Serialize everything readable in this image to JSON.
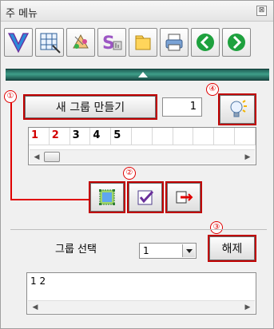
{
  "window": {
    "title": "주 메뉴",
    "close_glyph": "⊠"
  },
  "toolbar": {
    "icons": [
      "v-icon",
      "grid-edit-icon",
      "paint-icon",
      "s-chart-icon",
      "folder-icon",
      "printer-icon",
      "back-arrow-icon",
      "forward-arrow-icon"
    ]
  },
  "markers": {
    "m1": "①",
    "m2": "②",
    "m3": "③",
    "m4": "④"
  },
  "group": {
    "create_label": "새 그룹 만들기",
    "count_value": "1",
    "cells": [
      "1",
      "2",
      "3",
      "4",
      "5",
      "",
      "",
      "",
      "",
      "",
      ""
    ],
    "red_cells": [
      "1",
      "2"
    ]
  },
  "selection": {
    "label": "그룹 선택",
    "selected": "1",
    "release_label": "해제"
  },
  "result": {
    "text": "1 2"
  },
  "colors": {
    "accent_red": "#d30000",
    "splitter_green": "#3e9e89"
  }
}
